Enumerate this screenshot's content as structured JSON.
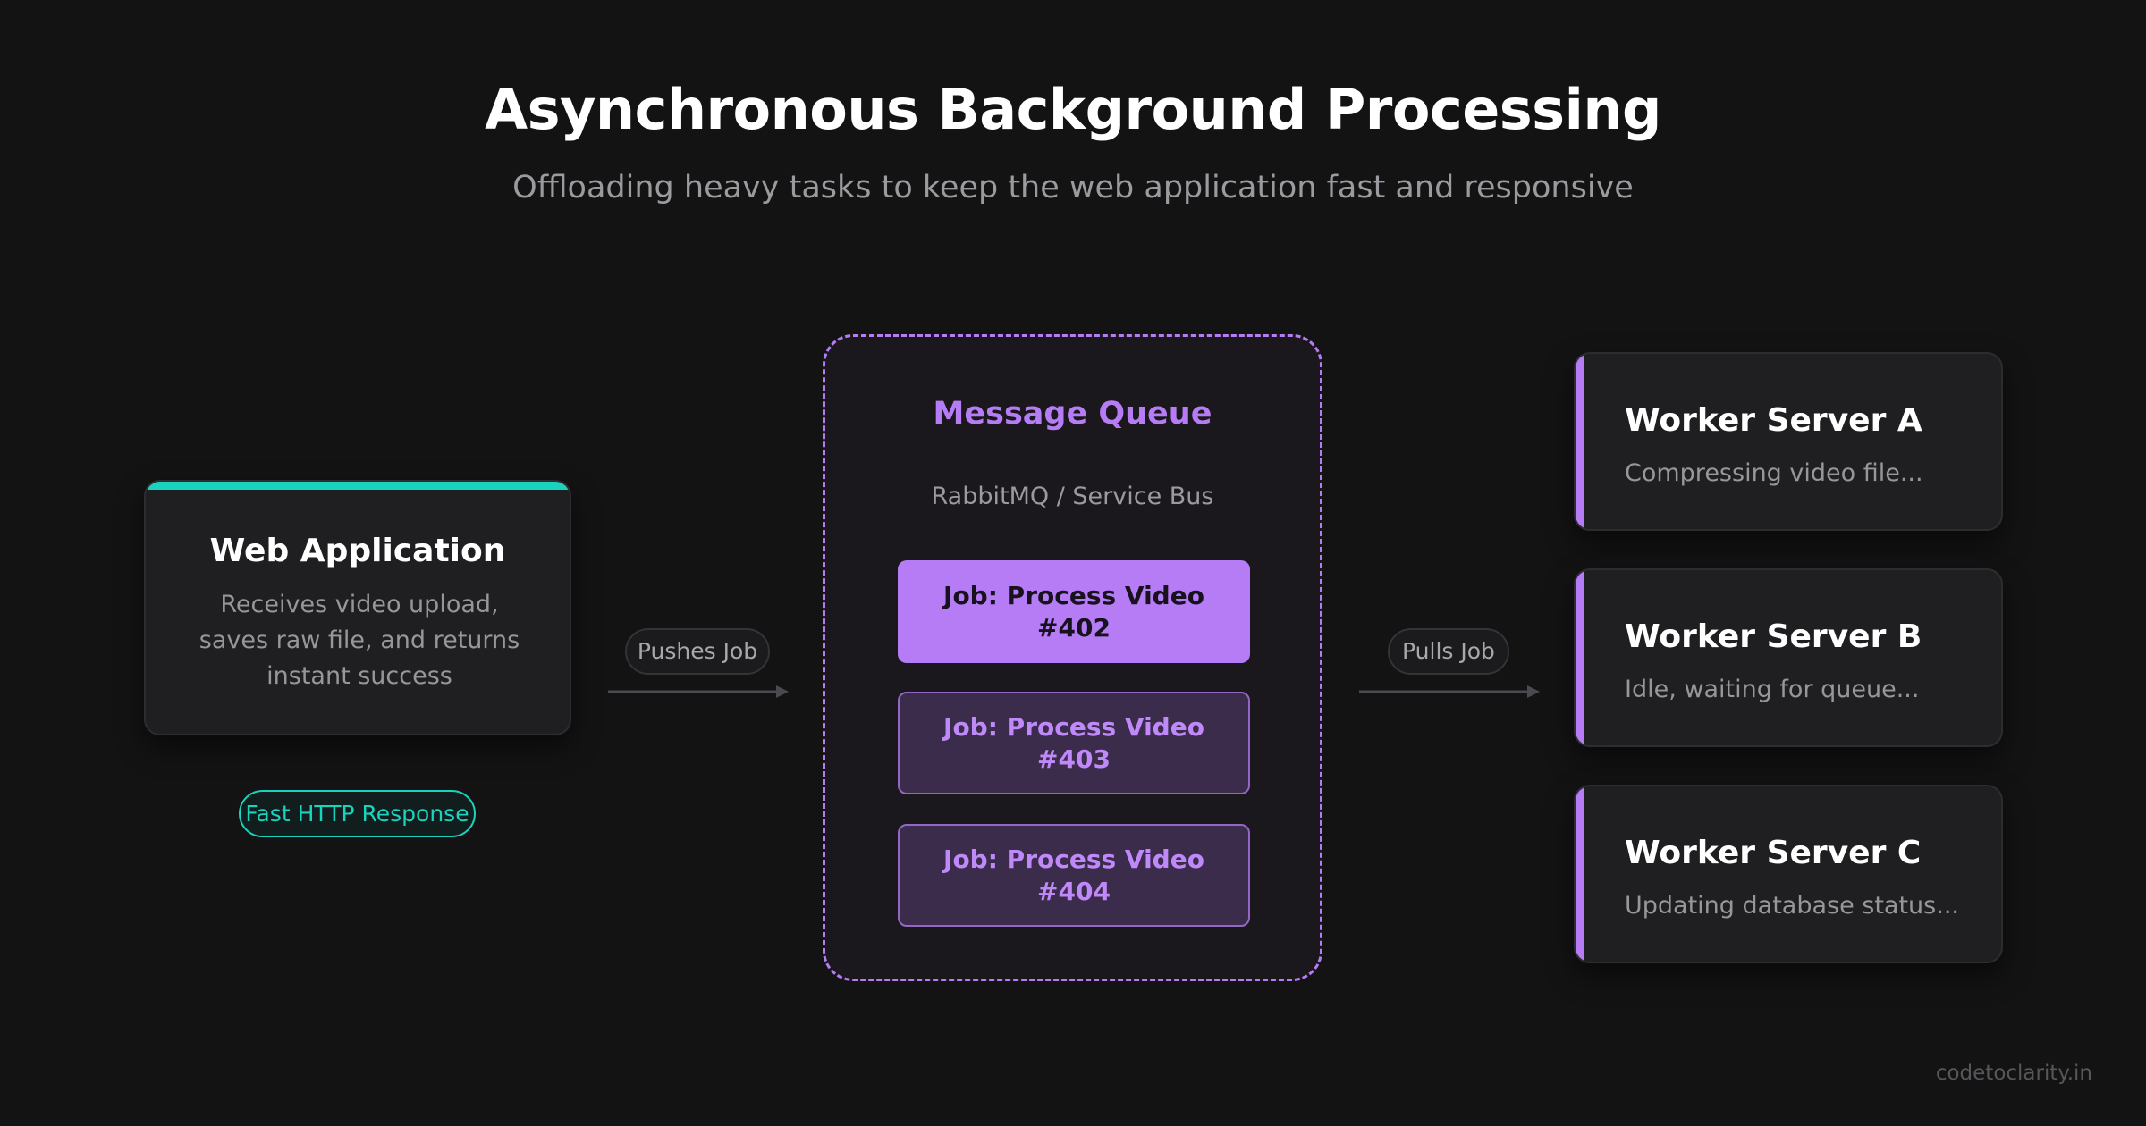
{
  "header": {
    "title": "Asynchronous Background Processing",
    "subtitle": "Offloading heavy tasks to keep the web application fast and responsive"
  },
  "web_app": {
    "title": "Web Application",
    "description": "Receives video upload, saves raw file, and returns instant success",
    "badge": "Fast HTTP Response"
  },
  "connectors": {
    "push_label": "Pushes Job",
    "pull_label": "Pulls Job"
  },
  "queue": {
    "title": "Message Queue",
    "subtitle": "RabbitMQ / Service Bus",
    "jobs": [
      {
        "label": "Job: Process Video #402",
        "state": "active"
      },
      {
        "label": "Job: Process Video #403",
        "state": "pending"
      },
      {
        "label": "Job: Process Video #404",
        "state": "pending"
      }
    ]
  },
  "workers": [
    {
      "title": "Worker Server A",
      "status": "Compressing video file..."
    },
    {
      "title": "Worker Server B",
      "status": "Idle, waiting for queue..."
    },
    {
      "title": "Worker Server C",
      "status": "Updating database status..."
    }
  ],
  "footer": {
    "watermark": "codetoclarity.in"
  },
  "colors": {
    "background": "#131314",
    "teal_accent": "#19d3be",
    "purple_accent": "#b57cf6",
    "card": "#1f1f21"
  }
}
